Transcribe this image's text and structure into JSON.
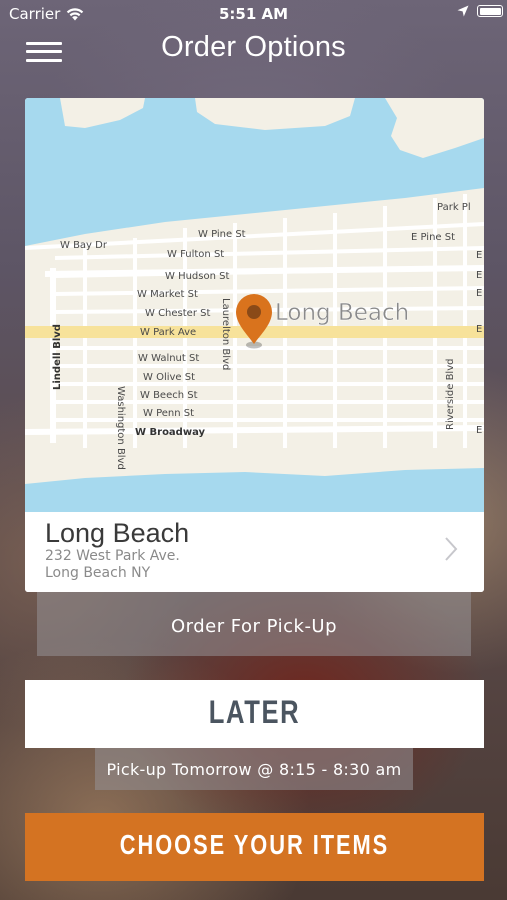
{
  "status_bar": {
    "carrier": "Carrier",
    "time": "5:51 AM"
  },
  "header": {
    "title": "Order Options",
    "menu_icon": "hamburger-menu-icon"
  },
  "map": {
    "place_label": "Long Beach",
    "streets": {
      "park_pl": "Park Pl",
      "w_bay_dr": "W Bay Dr",
      "w_pine_st": "W Pine St",
      "e_pine_st": "E Pine St",
      "w_fulton_st": "W Fulton St",
      "w_hudson_st": "W Hudson St",
      "w_market_st": "W Market St",
      "w_chester_st": "W Chester St",
      "w_park_ave": "W Park Ave",
      "w_walnut_st": "W Walnut St",
      "w_olive_st": "W Olive St",
      "w_beech_st": "W Beech St",
      "w_penn_st": "W Penn St",
      "w_broadway": "W Broadway",
      "lindell_blvd": "Lindell Blvd",
      "washington_blvd": "Washington Blvd",
      "laurelton_blvd": "Laurelton Blvd",
      "riverside_blvd": "Riverside Blvd",
      "e1": "E",
      "e2": "E",
      "e3": "E",
      "e4": "E",
      "e5": "E"
    },
    "colors": {
      "water": "#a6d9ee",
      "land": "#f3f0e6",
      "road": "#ffffff",
      "main_road": "#f7e29a",
      "pin": "#d9731d"
    }
  },
  "location": {
    "name": "Long Beach",
    "address_line1": "232 West Park Ave.",
    "address_line2": "Long Beach NY"
  },
  "order_type": {
    "label": "Order For Pick-Up"
  },
  "timing": {
    "button_label": "LATER",
    "pickup_time": "Pick-up Tomorrow @ 8:15 - 8:30 am"
  },
  "cta": {
    "label": "CHOOSE YOUR ITEMS",
    "color": "#d47322"
  }
}
